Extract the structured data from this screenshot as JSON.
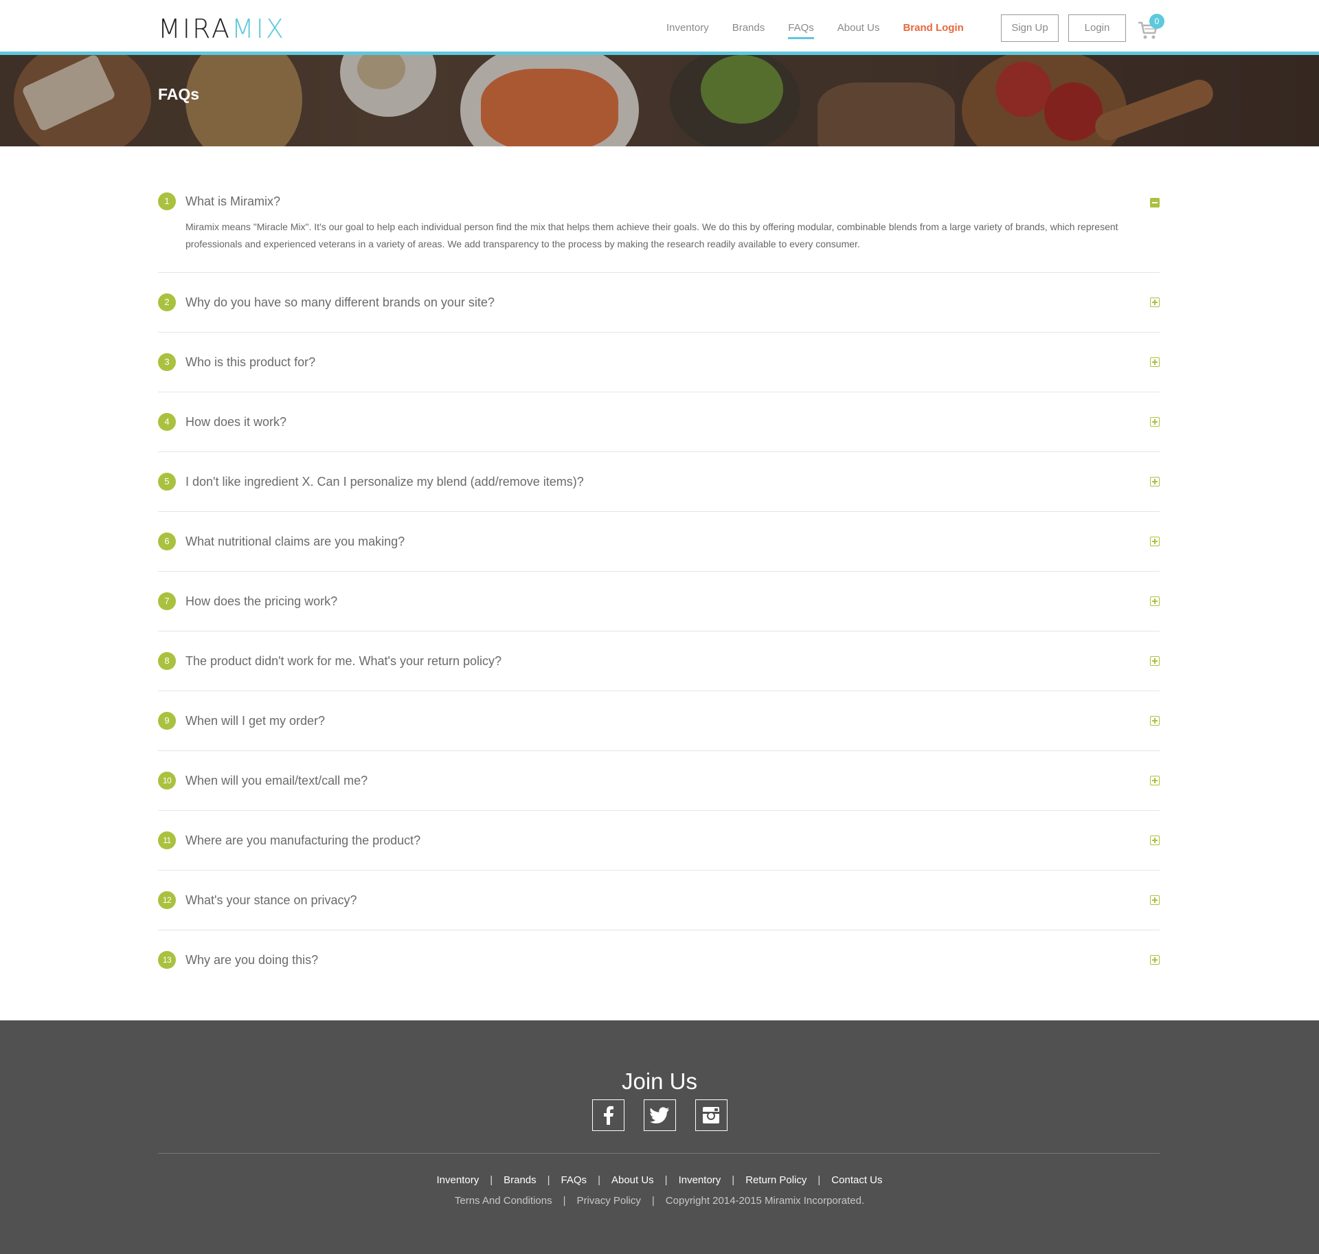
{
  "brand": {
    "logo_part1": "MIRA",
    "logo_part2": "MIX"
  },
  "nav": {
    "items": [
      {
        "label": "Inventory",
        "active": false
      },
      {
        "label": "Brands",
        "active": false
      },
      {
        "label": "FAQs",
        "active": true
      },
      {
        "label": "About Us",
        "active": false
      },
      {
        "label": "Brand Login",
        "highlight": true
      }
    ],
    "signup_label": "Sign Up",
    "login_label": "Login",
    "cart_count": "0"
  },
  "banner": {
    "title": "FAQs"
  },
  "faq": {
    "items": [
      {
        "num": "1",
        "question": "What is Miramix?",
        "open": true,
        "answer": "Miramix means \"Miracle Mix\". It's our goal to help each individual person find the mix that helps them achieve their goals. We do this by offering modular, combinable blends from a large variety of brands, which represent professionals and experienced veterans in a variety of areas. We add transparency to the process by making the research readily available to every consumer."
      },
      {
        "num": "2",
        "question": "Why do you have so many different brands on your site?"
      },
      {
        "num": "3",
        "question": "Who is this product for?"
      },
      {
        "num": "4",
        "question": "How does it work?"
      },
      {
        "num": "5",
        "question": "I don't like ingredient X. Can I personalize my blend (add/remove items)?"
      },
      {
        "num": "6",
        "question": "What nutritional claims are you making?"
      },
      {
        "num": "7",
        "question": "How does the pricing work?"
      },
      {
        "num": "8",
        "question": "The product didn't work for me. What's your return policy?"
      },
      {
        "num": "9",
        "question": "When will I get my order?"
      },
      {
        "num": "10",
        "question": "When will you email/text/call me?"
      },
      {
        "num": "11",
        "question": "Where are you manufacturing the product?"
      },
      {
        "num": "12",
        "question": "What's your stance on privacy?"
      },
      {
        "num": "13",
        "question": "Why are you doing this?"
      }
    ]
  },
  "footer": {
    "join_title": "Join Us",
    "social": [
      {
        "icon": "facebook-icon"
      },
      {
        "icon": "twitter-icon"
      },
      {
        "icon": "instagram-icon"
      }
    ],
    "links": [
      "Inventory",
      "Brands",
      "FAQs",
      "About Us",
      "Inventory",
      "Return Policy",
      "Contact Us"
    ],
    "legal": {
      "terms": "Terns And Conditions",
      "privacy": "Privacy Policy",
      "copyright": "Copyright 2014-2015 Miramix Incorporated."
    }
  },
  "colors": {
    "accent_blue": "#5ec8dd",
    "accent_green": "#a9c13f",
    "brand_login": "#e8673c",
    "footer_bg": "#515151"
  }
}
